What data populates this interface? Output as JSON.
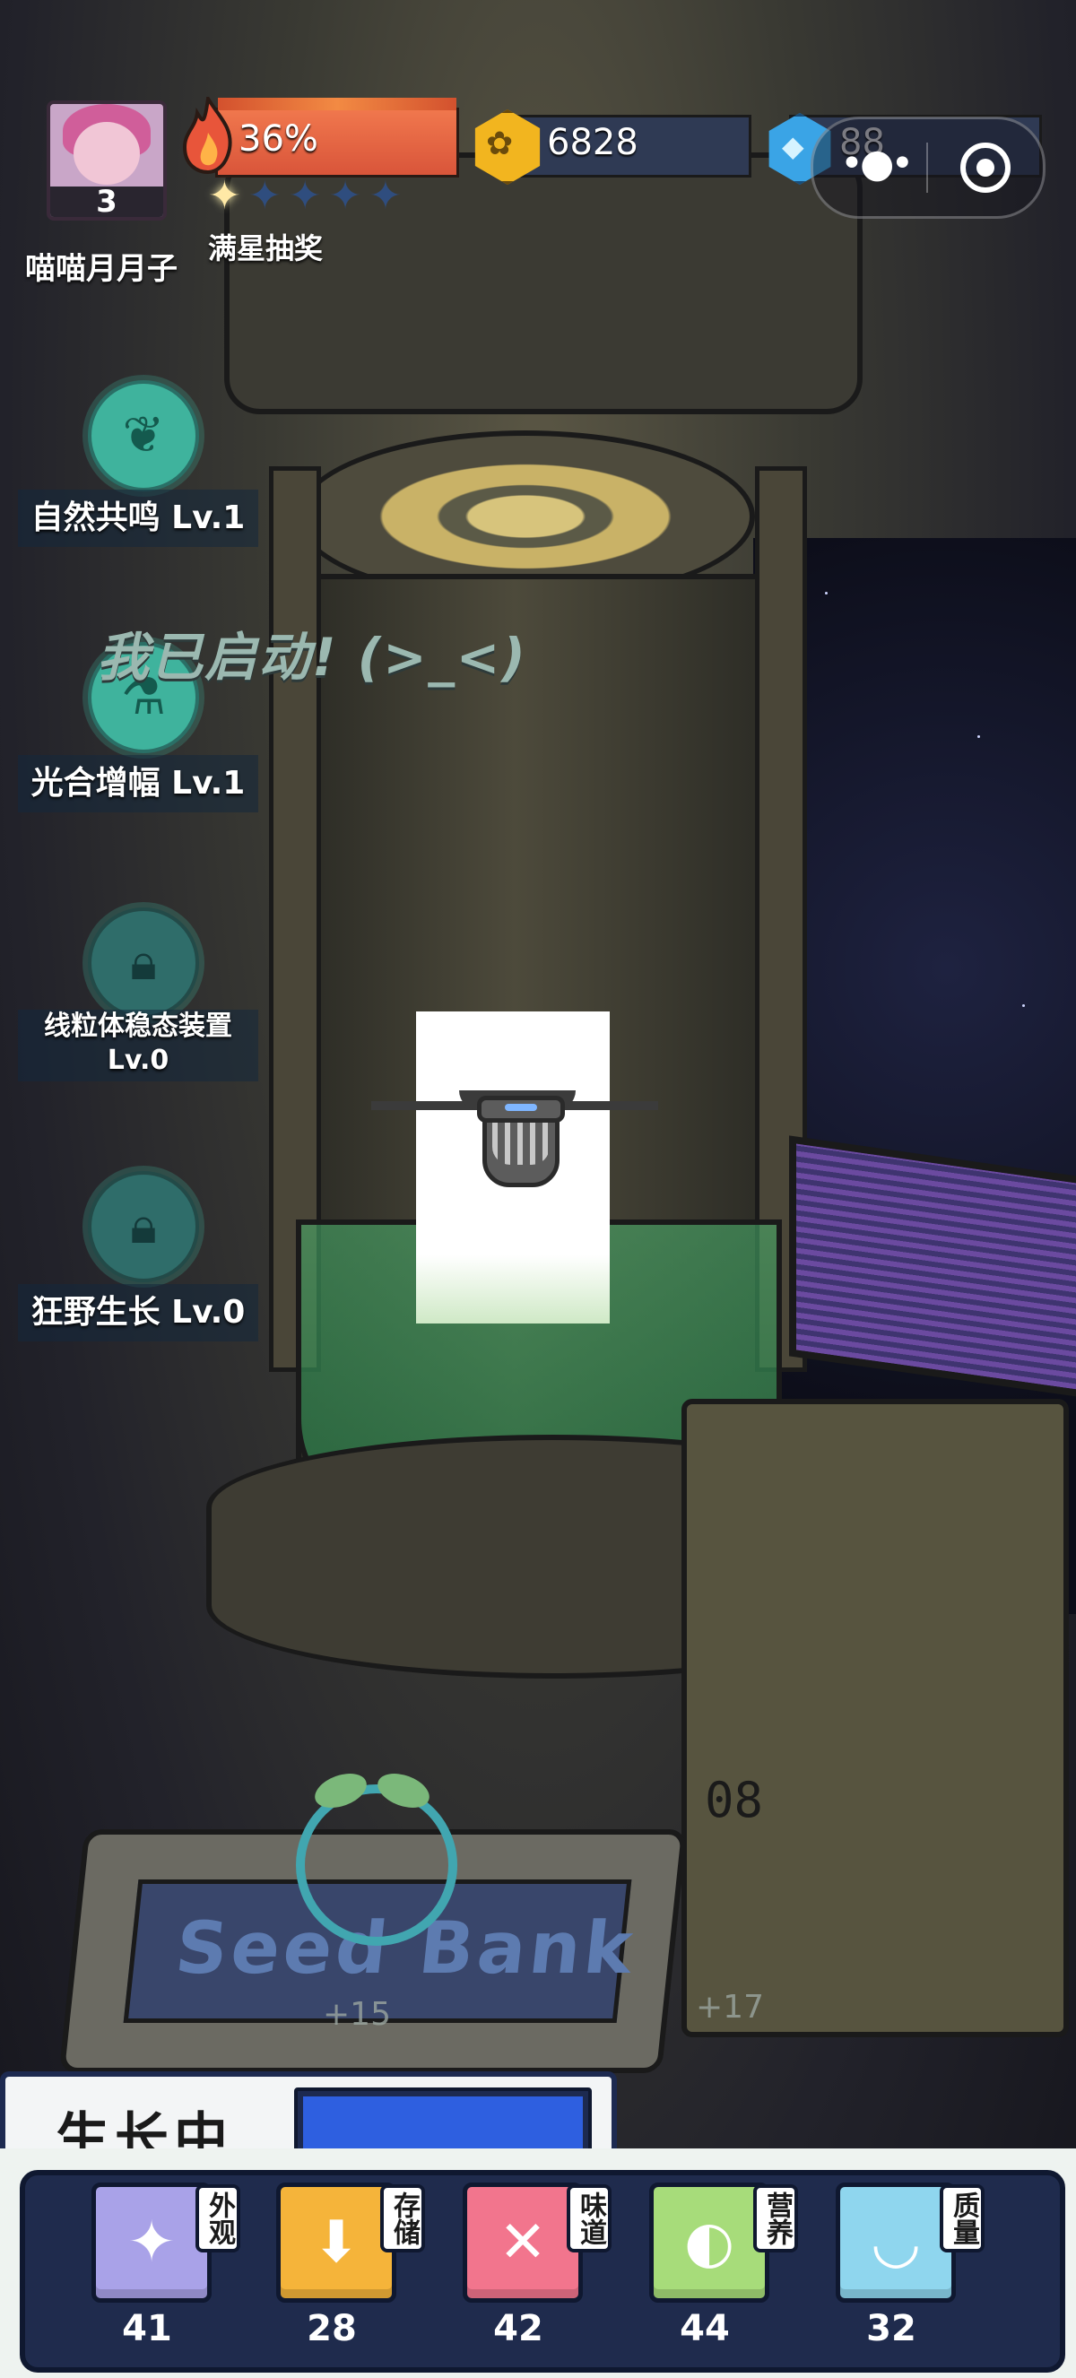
{
  "player": {
    "name": "喵喵月月子",
    "level": "3"
  },
  "heat": {
    "percent_text": "36%",
    "value": 0.36
  },
  "stars": {
    "label": "满星抽奖",
    "filled": 1,
    "total": 5
  },
  "currency": {
    "coins": "6828",
    "gems": "88"
  },
  "skills": [
    {
      "name": "自然共鸣 Lv.1",
      "icon": "leaf-circle-icon",
      "locked": false
    },
    {
      "name": "光合增幅 Lv.1",
      "icon": "flask-sprout-icon",
      "locked": false
    },
    {
      "name": "线粒体稳态装置",
      "name2": "Lv.0",
      "icon": "lock-icon",
      "locked": true
    },
    {
      "name": "狂野生长 Lv.0",
      "icon": "lock-icon",
      "locked": true
    }
  ],
  "speech": "我已启动! (>_<)",
  "scene": {
    "machine_number": "08",
    "console_logo": "Seed Bank",
    "gains": [
      "+15",
      "+17"
    ]
  },
  "status": {
    "label": "生长中",
    "progress": 1.0
  },
  "attributes": [
    {
      "tag": "外观",
      "value": "41",
      "color": "#a9a2e8",
      "icon": "sparkle-icon"
    },
    {
      "tag": "存储",
      "value": "28",
      "color": "#f5b43a",
      "icon": "box-icon"
    },
    {
      "tag": "味道",
      "value": "42",
      "color": "#f2758d",
      "icon": "fork-knife-icon"
    },
    {
      "tag": "营养",
      "value": "44",
      "color": "#a7dc7a",
      "icon": "lemon-icon"
    },
    {
      "tag": "质量",
      "value": "32",
      "color": "#8fd6ee",
      "icon": "muscle-icon"
    }
  ]
}
